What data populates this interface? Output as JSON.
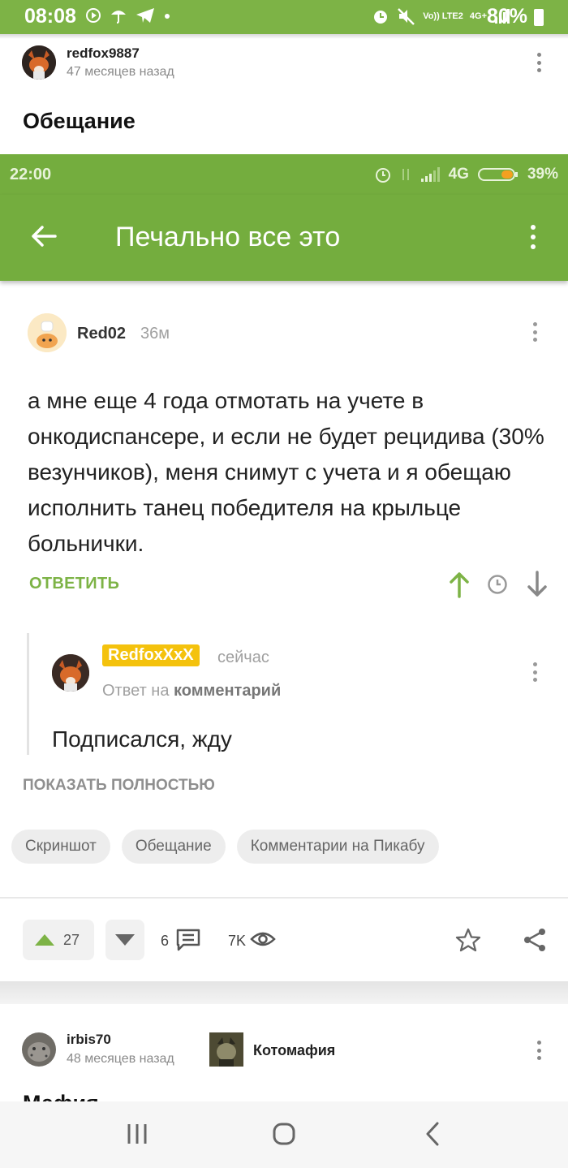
{
  "status_bar": {
    "time": "08:08",
    "network_label": "Vo)) LTE2",
    "data_label": "4G+",
    "battery": "80%"
  },
  "post1": {
    "username": "redfox9887",
    "age": "47 месяцев назад",
    "title": "Обещание"
  },
  "screenshot": {
    "status_time": "22:00",
    "status_network": "4G",
    "status_battery": "39%",
    "app_title": "Печально все это",
    "comment": {
      "username": "Red02",
      "time": "36м",
      "text": "а мне еще 4 года отмотать на учете в онкодиспансере, и если не будет рецидива (30% везунчиков), меня снимут с учета и я обещаю исполнить танец победителя на крыльце больнички.",
      "reply_label": "ОТВЕТИТЬ"
    },
    "reply": {
      "username": "RedfoxXxX",
      "time": "сейчас",
      "reply_to_prefix": "Ответ на",
      "reply_to_target": "комментарий",
      "text": "Подписался, жду"
    }
  },
  "show_full": "ПОКАЗАТЬ ПОЛНОСТЬЮ",
  "tags": [
    "Скриншот",
    "Обещание",
    "Комментарии на Пикабу"
  ],
  "actions": {
    "upvotes": "27",
    "comments": "6",
    "views": "7K"
  },
  "post2": {
    "username": "irbis70",
    "age": "48 месяцев назад",
    "community": "Котомафия",
    "title_partial": "Мафия"
  },
  "colors": {
    "brand_green": "#7db346",
    "badge_yellow": "#f4c20d"
  }
}
